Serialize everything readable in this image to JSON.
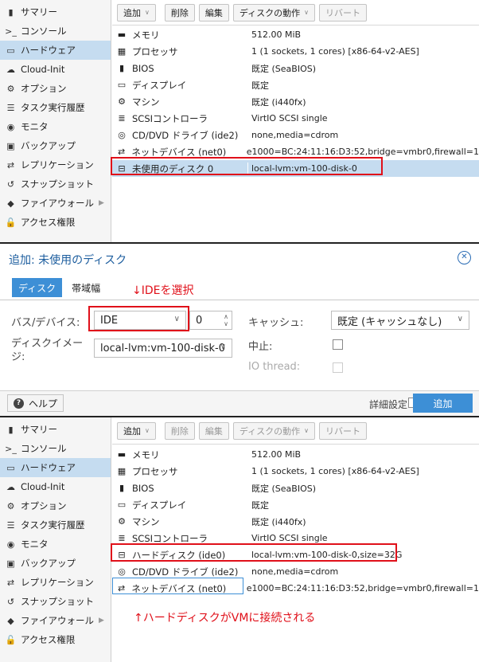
{
  "sidebar": {
    "items": [
      {
        "icon": "book-icon",
        "glyph": "▮",
        "label": "サマリー"
      },
      {
        "icon": "console-icon",
        "glyph": ">_",
        "label": "コンソール"
      },
      {
        "icon": "monitor-icon",
        "glyph": "▭",
        "label": "ハードウェア"
      },
      {
        "icon": "cloud-icon",
        "glyph": "☁",
        "label": "Cloud-Init"
      },
      {
        "icon": "gear-icon",
        "glyph": "⚙",
        "label": "オプション"
      },
      {
        "icon": "list-icon",
        "glyph": "☰",
        "label": "タスク実行履歴"
      },
      {
        "icon": "eye-icon",
        "glyph": "◉",
        "label": "モニタ"
      },
      {
        "icon": "floppy-icon",
        "glyph": "▣",
        "label": "バックアップ"
      },
      {
        "icon": "retweet-icon",
        "glyph": "⇄",
        "label": "レプリケーション"
      },
      {
        "icon": "history-icon",
        "glyph": "↺",
        "label": "スナップショット"
      },
      {
        "icon": "shield-icon",
        "glyph": "◆",
        "label": "ファイアウォール"
      },
      {
        "icon": "unlock-icon",
        "glyph": "🔓",
        "label": "アクセス権限"
      }
    ]
  },
  "toolbar": {
    "add": "追加",
    "delete": "削除",
    "edit": "編集",
    "disk_action": "ディスクの動作",
    "revert": "リバート"
  },
  "hardware_before": [
    {
      "icon": "memory-icon",
      "glyph": "▬",
      "label": "メモリ",
      "value": "512.00 MiB"
    },
    {
      "icon": "cpu-icon",
      "glyph": "▦",
      "label": "プロセッサ",
      "value": "1 (1 sockets, 1 cores) [x86-64-v2-AES]"
    },
    {
      "icon": "chip-icon",
      "glyph": "▮",
      "label": "BIOS",
      "value": "既定 (SeaBIOS)"
    },
    {
      "icon": "desktop-icon",
      "glyph": "▭",
      "label": "ディスプレイ",
      "value": "既定"
    },
    {
      "icon": "cogs-icon",
      "glyph": "⚙",
      "label": "マシン",
      "value": "既定 (i440fx)"
    },
    {
      "icon": "database-icon",
      "glyph": "≣",
      "label": "SCSIコントローラ",
      "value": "VirtIO SCSI single"
    },
    {
      "icon": "cdrom-icon",
      "glyph": "◎",
      "label": "CD/DVD ドライブ (ide2)",
      "value": "none,media=cdrom"
    },
    {
      "icon": "network-icon",
      "glyph": "⇄",
      "label": "ネットデバイス (net0)",
      "value": "e1000=BC:24:11:16:D3:52,bridge=vmbr0,firewall=1"
    },
    {
      "icon": "hdd-icon",
      "glyph": "⊟",
      "label": "未使用のディスク 0",
      "value": "local-lvm:vm-100-disk-0"
    }
  ],
  "hardware_after": [
    {
      "icon": "memory-icon",
      "glyph": "▬",
      "label": "メモリ",
      "value": "512.00 MiB"
    },
    {
      "icon": "cpu-icon",
      "glyph": "▦",
      "label": "プロセッサ",
      "value": "1 (1 sockets, 1 cores) [x86-64-v2-AES]"
    },
    {
      "icon": "chip-icon",
      "glyph": "▮",
      "label": "BIOS",
      "value": "既定 (SeaBIOS)"
    },
    {
      "icon": "desktop-icon",
      "glyph": "▭",
      "label": "ディスプレイ",
      "value": "既定"
    },
    {
      "icon": "cogs-icon",
      "glyph": "⚙",
      "label": "マシン",
      "value": "既定 (i440fx)"
    },
    {
      "icon": "database-icon",
      "glyph": "≣",
      "label": "SCSIコントローラ",
      "value": "VirtIO SCSI single"
    },
    {
      "icon": "hdd-icon",
      "glyph": "⊟",
      "label": "ハードディスク (ide0)",
      "value": "local-lvm:vm-100-disk-0,size=32G"
    },
    {
      "icon": "cdrom-icon",
      "glyph": "◎",
      "label": "CD/DVD ドライブ (ide2)",
      "value": "none,media=cdrom"
    },
    {
      "icon": "network-icon",
      "glyph": "⇄",
      "label": "ネットデバイス (net0)",
      "value": "e1000=BC:24:11:16:D3:52,bridge=vmbr0,firewall=1"
    }
  ],
  "dialog": {
    "title": "追加: 未使用のディスク",
    "tab_disk": "ディスク",
    "tab_bandwidth": "帯域幅",
    "bus_label": "バス/デバイス:",
    "bus_value": "IDE",
    "device_number": "0",
    "disk_image_label": "ディスクイメージ:",
    "disk_image_value": "local-lvm:vm-100-disk-0",
    "cache_label": "キャッシュ:",
    "cache_value": "既定 (キャッシュなし)",
    "discard_label": "中止:",
    "io_thread_label": "IO thread:",
    "help": "ヘルプ",
    "advanced": "詳細設定",
    "add": "追加"
  },
  "annotations": {
    "select_ide": "↓IDEを選択",
    "attached": "↑ハードディスクがVMに接続される"
  },
  "colors": {
    "accent": "#3d8fd6",
    "selection": "#c5dcf0",
    "highlight_red": "#e0101a"
  }
}
